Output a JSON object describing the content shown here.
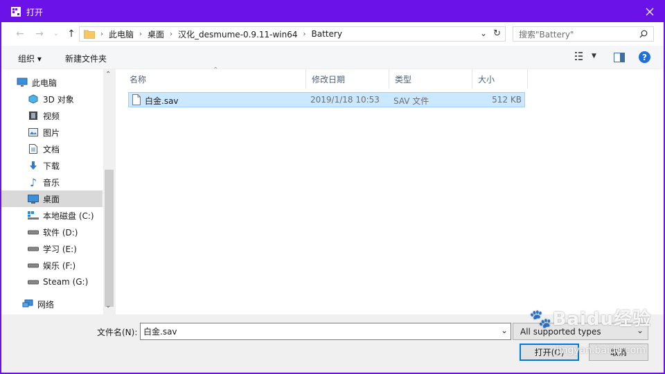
{
  "window": {
    "title": "打开"
  },
  "address": {
    "crumbs": [
      "此电脑",
      "桌面",
      "汉化_desmume-0.9.11-win64",
      "Battery"
    ],
    "search_placeholder": "搜索\"Battery\""
  },
  "toolbar": {
    "organize": "组织 ▾",
    "new_folder": "新建文件夹",
    "help": "?"
  },
  "nav": {
    "items": [
      {
        "label": "此电脑",
        "icon": "computer-icon"
      },
      {
        "label": "3D 对象",
        "icon": "cube-icon"
      },
      {
        "label": "视频",
        "icon": "film-icon"
      },
      {
        "label": "图片",
        "icon": "picture-icon"
      },
      {
        "label": "文档",
        "icon": "document-icon"
      },
      {
        "label": "下载",
        "icon": "download-arrow-icon"
      },
      {
        "label": "音乐",
        "icon": "music-note-icon"
      },
      {
        "label": "桌面",
        "icon": "desktop-icon",
        "selected": true
      },
      {
        "label": "本地磁盘 (C:)",
        "icon": "windows-drive-icon"
      },
      {
        "label": "软件 (D:)",
        "icon": "drive-icon"
      },
      {
        "label": "学习 (E:)",
        "icon": "drive-icon"
      },
      {
        "label": "娱乐 (F:)",
        "icon": "drive-icon"
      },
      {
        "label": "Steam (G:)",
        "icon": "drive-icon"
      },
      {
        "label": "网络",
        "icon": "network-icon"
      }
    ]
  },
  "columns": {
    "name": "名称",
    "modified": "修改日期",
    "type": "类型",
    "size": "大小"
  },
  "files": [
    {
      "name": "白金.sav",
      "modified": "2019/1/18 10:53",
      "type": "SAV 文件",
      "size": "512 KB"
    }
  ],
  "bottom": {
    "filename_label": "文件名(N):",
    "filename_value": "白金.sav",
    "filetype_value": "All supported types",
    "open_label": "打开(O)",
    "cancel_label": "取消"
  },
  "watermark": {
    "text": "Baidu经验",
    "url": "jingyan.baidu.com"
  },
  "colors": {
    "titlebar": "#6b12e8",
    "selection": "#cce8ff"
  }
}
